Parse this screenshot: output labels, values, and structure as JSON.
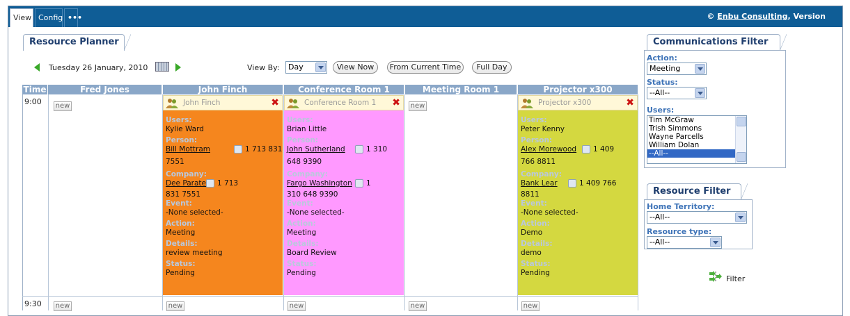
{
  "topbar": {
    "tabs": [
      {
        "label": "View"
      },
      {
        "label": "Config"
      },
      {
        "label": "•••"
      }
    ],
    "copyright_symbol": "©",
    "company_link": "Enbu Consulting",
    "version_text": ", Version"
  },
  "planner": {
    "title": "Resource Planner",
    "date": "Tuesday 26 January, 2010",
    "view_by_label": "View By:",
    "view_by_value": "Day",
    "buttons": [
      "View Now",
      "From Current Time",
      "Full Day"
    ],
    "time_header": "Time",
    "columns": [
      "Fred Jones",
      "John Finch",
      "Conference Room 1",
      "Meeting Room 1",
      "Projector x300"
    ],
    "times": [
      "9:00",
      "9:30"
    ],
    "new_label": "new"
  },
  "cards": [
    {
      "title": "John Finch",
      "color": "#f5861e",
      "labels": {
        "users": "Users:",
        "person": "Person:",
        "company": "Company:",
        "event": "Event:",
        "action": "Action:",
        "details": "Details:",
        "status": "Status:"
      },
      "users": "Kylie Ward",
      "person_name": "Bill Mottram",
      "person_phone_a": "1 713 831",
      "person_phone_b": "7551",
      "company_name": "Dee Paratek",
      "company_phone_a": "1 713",
      "company_phone_b": "831 7551",
      "event": "-None selected-",
      "action": "Meeting",
      "details": "review meeting",
      "status": "Pending"
    },
    {
      "title": "Conference Room 1",
      "color": "#ff99ff",
      "labels": {
        "users": "Users:",
        "person": "Person:",
        "company": "Company:",
        "event": "Event:",
        "action": "Action:",
        "details": "Details:",
        "status": "Status:"
      },
      "users": "Brian Little",
      "person_name": "John Sutherland",
      "person_phone_a": "1 310",
      "person_phone_b": "648 9390",
      "company_name": "Fargo Washington",
      "company_phone_a": "1",
      "company_phone_b": "310 648 9390",
      "event": "-None selected-",
      "action": "Meeting",
      "details": "Board Review",
      "status": "Pending"
    },
    {
      "title": "Projector x300",
      "color": "#d4d840",
      "labels": {
        "users": "Users:",
        "person": "Person:",
        "company": "Company:",
        "event": "Event:",
        "action": "Action:",
        "details": "Details:",
        "status": "Status:"
      },
      "users": "Peter Kenny",
      "person_name": "Alex Morewood",
      "person_phone_a": "1 409",
      "person_phone_b": "766 8811",
      "company_name": "Bank Lear",
      "company_phone_a": "1 409 766",
      "company_phone_b": "8811",
      "event": "-None selected-",
      "action": "Demo",
      "details": "demo",
      "status": "Pending"
    }
  ],
  "comm_filter": {
    "title": "Communications Filter",
    "action_label": "Action:",
    "action_value": "Meeting",
    "status_label": "Status:",
    "status_value": "--All--",
    "users_label": "Users:",
    "users_options": [
      "Tim McGraw",
      "Trish Simmons",
      "Wayne Parcells",
      "William Dolan",
      "--All--"
    ]
  },
  "resource_filter": {
    "title": "Resource Filter",
    "territory_label": "Home Territory:",
    "territory_value": "--All--",
    "type_label": "Resource type:",
    "type_value": "--All--",
    "filter_label": "Filter"
  },
  "colors": {
    "topbar": "#0f5d96",
    "header": "#8aa7c8",
    "nav_arrow": "#39a828"
  }
}
